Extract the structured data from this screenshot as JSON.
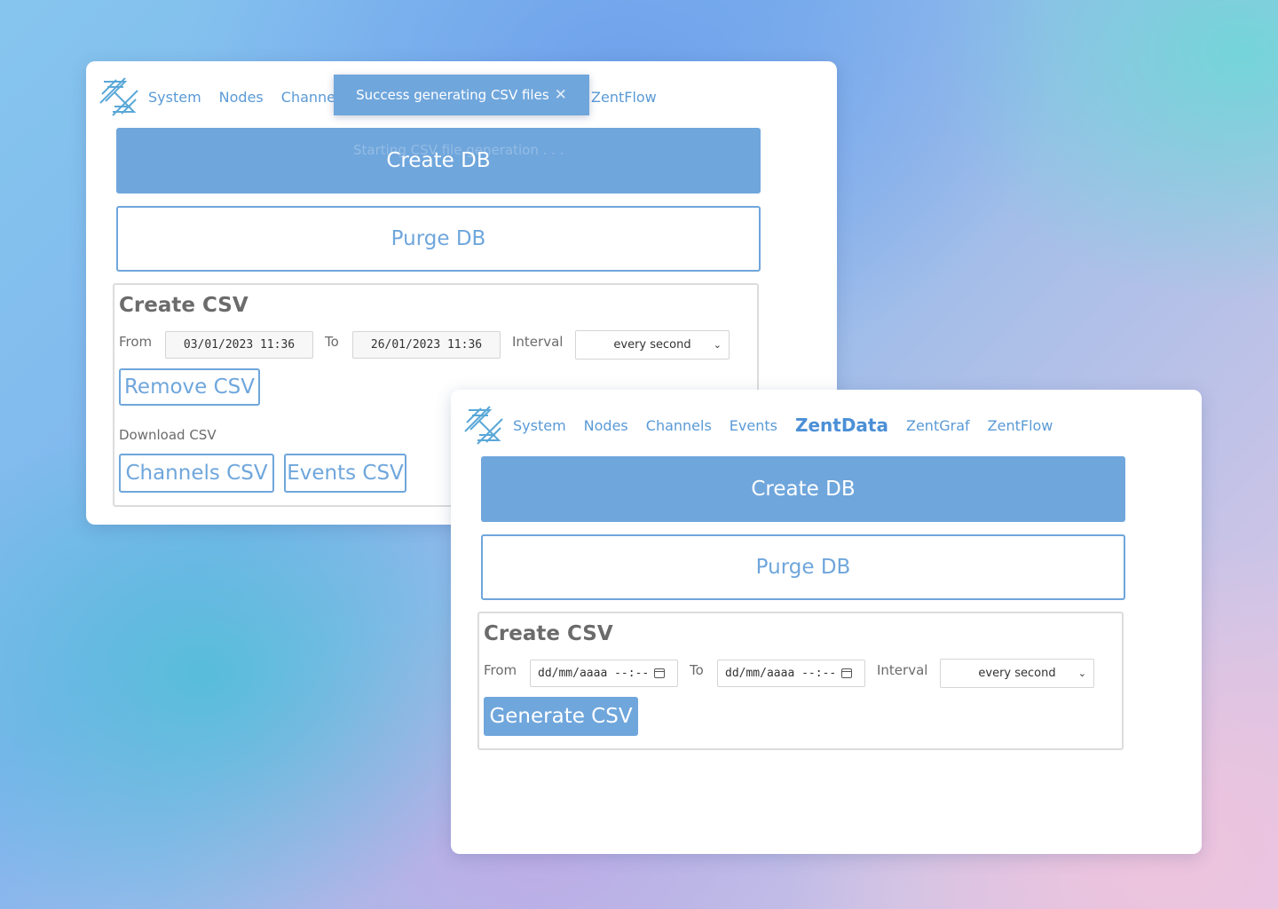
{
  "window1": {
    "nav": [
      "System",
      "Nodes",
      "Channe",
      "ZentFlow"
    ],
    "create_db": "Create DB",
    "purge_db": "Purge DB",
    "create_csv_title": "Create CSV",
    "from_label": "From",
    "from_value": "03/01/2023 11:36",
    "to_label": "To",
    "to_value": "26/01/2023 11:36",
    "interval_label": "Interval",
    "interval_value": "every second",
    "remove_csv": "Remove CSV",
    "download_label": "Download CSV",
    "channels_csv": "Channels CSV",
    "events_csv": "Events CSV"
  },
  "toast": {
    "message": "Success generating CSV files",
    "close_glyph": "✕",
    "ghost_message": "Starting CSV file generation . . ."
  },
  "window2": {
    "nav": [
      "System",
      "Nodes",
      "Channels",
      "Events",
      "ZentData",
      "ZentGraf",
      "ZentFlow"
    ],
    "active_nav": "ZentData",
    "create_db": "Create DB",
    "purge_db": "Purge DB",
    "create_csv_title": "Create CSV",
    "from_label": "From",
    "from_placeholder": "dd/mm/aaaa --:--",
    "to_label": "To",
    "to_placeholder": "dd/mm/aaaa --:--",
    "interval_label": "Interval",
    "interval_value": "every second",
    "generate_csv": "Generate CSV"
  },
  "colors": {
    "accent": "#6fa6dc",
    "nav_text": "#5a9ad6"
  }
}
